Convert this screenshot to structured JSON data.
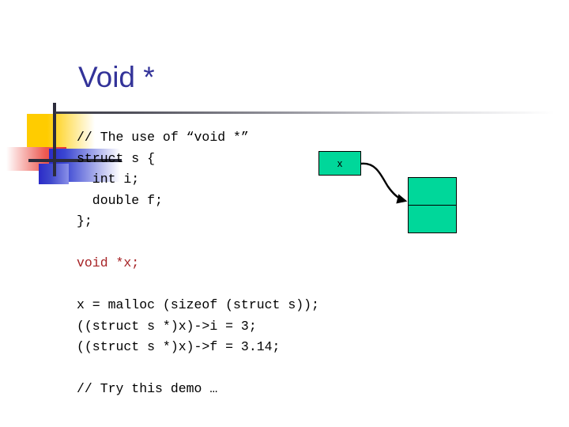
{
  "slide": {
    "title": "Void *",
    "title_color": "#333399",
    "code_color": "#000000",
    "highlight_color": "#A62225",
    "box_fill_color": "#00D79A",
    "code_lines": [
      {
        "text": "// The use of “void *”",
        "style": "plain"
      },
      {
        "text": "struct s {",
        "style": "plain"
      },
      {
        "text": "  int i;",
        "style": "plain"
      },
      {
        "text": "  double f;",
        "style": "plain"
      },
      {
        "text": "};",
        "style": "plain"
      },
      {
        "text": "",
        "style": "blank"
      },
      {
        "text": "void *x;",
        "style": "red"
      },
      {
        "text": "",
        "style": "blank"
      },
      {
        "text": "x = malloc (sizeof (struct s));",
        "style": "plain"
      },
      {
        "text": "((struct s *)x)->i = 3;",
        "style": "plain"
      },
      {
        "text": "((struct s *)x)->f = 3.14;",
        "style": "plain"
      },
      {
        "text": "",
        "style": "blank"
      },
      {
        "text": "// Try this demo …",
        "style": "plain"
      }
    ],
    "diagram": {
      "pointer_label": "x",
      "heap_cells": [
        "",
        ""
      ]
    },
    "decoration": {
      "yellow": "#FFCC00",
      "red": "#E8332E",
      "blue": "#2A2AC8",
      "line": "#2C2C3C"
    }
  }
}
